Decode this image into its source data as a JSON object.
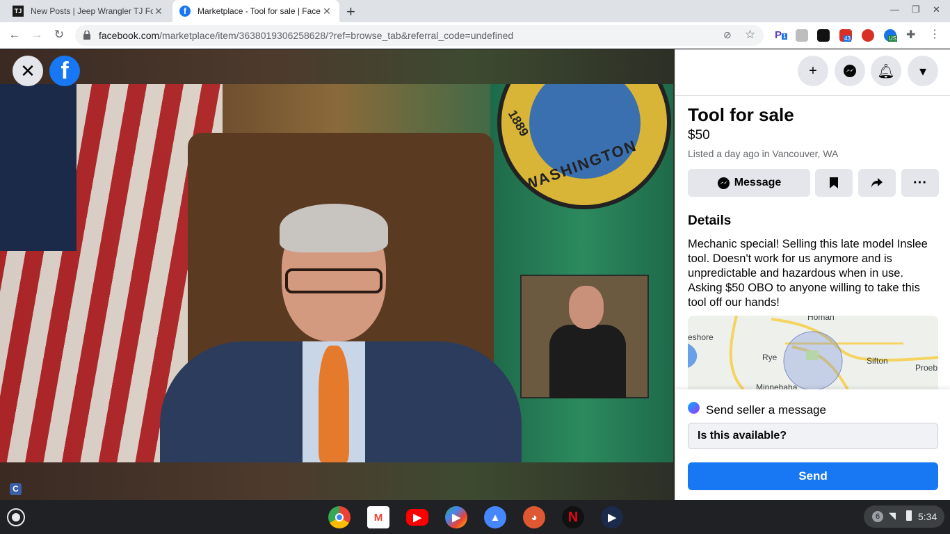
{
  "browser": {
    "tabs": [
      {
        "title": "New Posts | Jeep Wrangler TJ Fo",
        "favicon": "TJ"
      },
      {
        "title": "Marketplace - Tool for sale | Face",
        "favicon": "f"
      }
    ],
    "url_host": "facebook.com",
    "url_path": "/marketplace/item/3638019306258628/?ref=browse_tab&referral_code=undefined",
    "extensions": {
      "ext1_badge": "1",
      "ext2_badge": "43",
      "ext3_badge": "US"
    }
  },
  "viewer": {
    "seal_text": "WASHINGTON",
    "seal_year": "1889",
    "corner_badge": "C"
  },
  "listing": {
    "title": "Tool for sale",
    "price": "$50",
    "listed": "Listed a day ago in Vancouver, WA",
    "message_button": "Message",
    "details_heading": "Details",
    "details_text": "Mechanic special! Selling this late model Inslee tool. Doesn't work for us anymore and is unpredictable and hazardous when in use. Asking $50 OBO to anyone willing to take this tool off our hands!",
    "map_labels": {
      "homan": "Homan",
      "eshore": "eshore",
      "rye": "Rye",
      "sifton": "Sifton",
      "proeb": "Proeb",
      "minnehaha": "Minnehaha"
    }
  },
  "send": {
    "heading": "Send seller a message",
    "input_value": "Is this available?",
    "button": "Send"
  },
  "shelf": {
    "notification_count": "6",
    "time": "5:34"
  },
  "colors": {
    "facebook_blue": "#1877f2",
    "panel_bg": "#ffffff",
    "button_gray": "#e4e6eb"
  }
}
